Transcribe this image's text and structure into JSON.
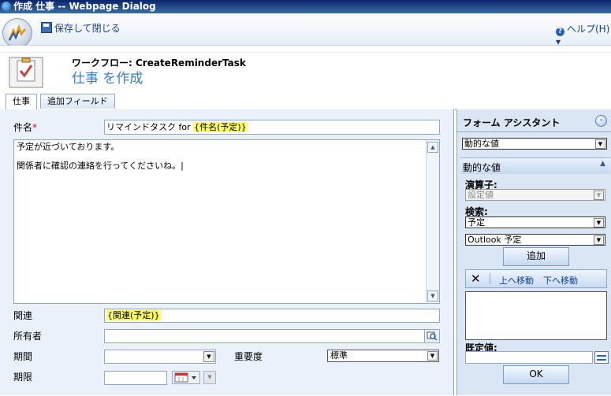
{
  "window": {
    "title": "作成 仕事 -- Webpage Dialog"
  },
  "toolbar": {
    "save_close": "保存して閉じる",
    "help": "ヘルプ(H)"
  },
  "header": {
    "workflow": "ワークフロー: CreateReminderTask",
    "title": "仕事 を作成"
  },
  "tabs": [
    {
      "label": "仕事"
    },
    {
      "label": "追加フィールド"
    }
  ],
  "form": {
    "subject_label": "件名",
    "subject_required": "*",
    "subject_prefix": "リマインドタスク for ",
    "subject_token": "{件名(予定)}",
    "body_line1": "予定が近づいております。",
    "body_line2": "関係者に確認の連絡を行ってくださいね。|",
    "regarding_label": "関連",
    "regarding_token": "{関連(予定)}",
    "owner_label": "所有者",
    "duration_label": "期間",
    "priority_label": "重要度",
    "priority_value": "標準",
    "due_label": "期限"
  },
  "assistant": {
    "title": "フォーム アシスタント",
    "mode": "動的な値",
    "section": "動的な値",
    "operator_label": "演算子:",
    "operator_value": "設定値",
    "lookfor_label": "検索:",
    "lookfor_value": "予定",
    "lookfor_field": "Outlook 予定",
    "add": "追加",
    "move_up": "上へ移動",
    "move_down": "下へ移動",
    "default_label": "既定値:",
    "ok": "OK"
  }
}
